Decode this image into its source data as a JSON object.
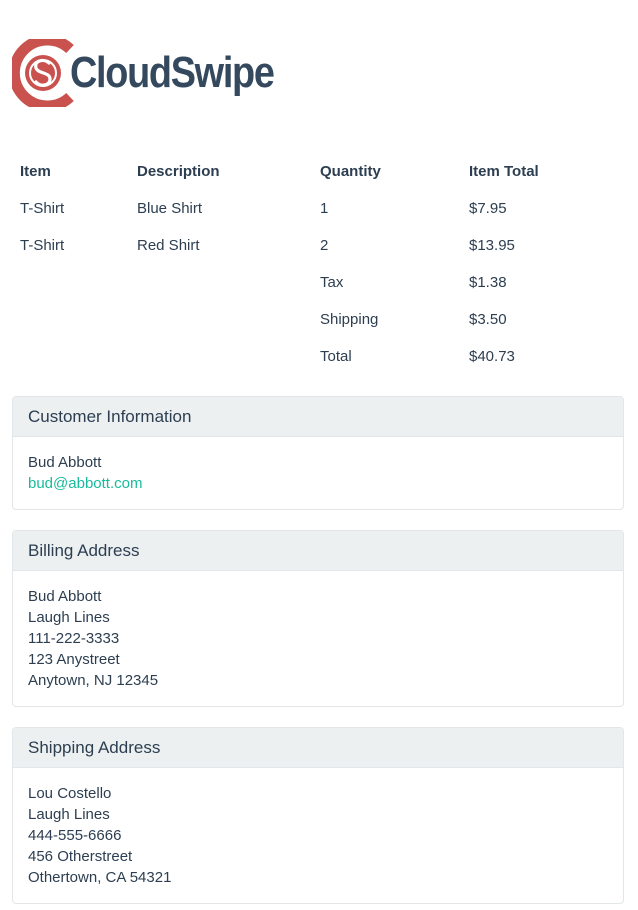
{
  "brand": {
    "name": "CloudSwipe",
    "icon": "cloudswipe-logo-icon",
    "colors": {
      "ring": "#c9524f",
      "text": "#34495e"
    }
  },
  "order_table": {
    "headers": [
      "Item",
      "Description",
      "Quantity",
      "Item Total"
    ],
    "rows": [
      {
        "item": "T-Shirt",
        "description": "Blue Shirt",
        "quantity": "1",
        "total": "$7.95"
      },
      {
        "item": "T-Shirt",
        "description": "Red Shirt",
        "quantity": "2",
        "total": "$13.95"
      }
    ],
    "summary": [
      {
        "label": "Tax",
        "value": "$1.38"
      },
      {
        "label": "Shipping",
        "value": "$3.50"
      },
      {
        "label": "Total",
        "value": "$40.73"
      }
    ]
  },
  "customer": {
    "title": "Customer Information",
    "name": "Bud Abbott",
    "email": "bud@abbott.com"
  },
  "billing": {
    "title": "Billing Address",
    "lines": [
      "Bud Abbott",
      "Laugh Lines",
      "111-222-3333",
      "123 Anystreet",
      "Anytown, NJ 12345"
    ]
  },
  "shipping": {
    "title": "Shipping Address",
    "lines": [
      "Lou Costello",
      "Laugh Lines",
      "444-555-6666",
      "456 Otherstreet",
      "Othertown, CA 54321"
    ]
  },
  "colors": {
    "panel_header_bg": "#ecf0f1",
    "link": "#18bc9c",
    "text": "#2c3e50"
  }
}
